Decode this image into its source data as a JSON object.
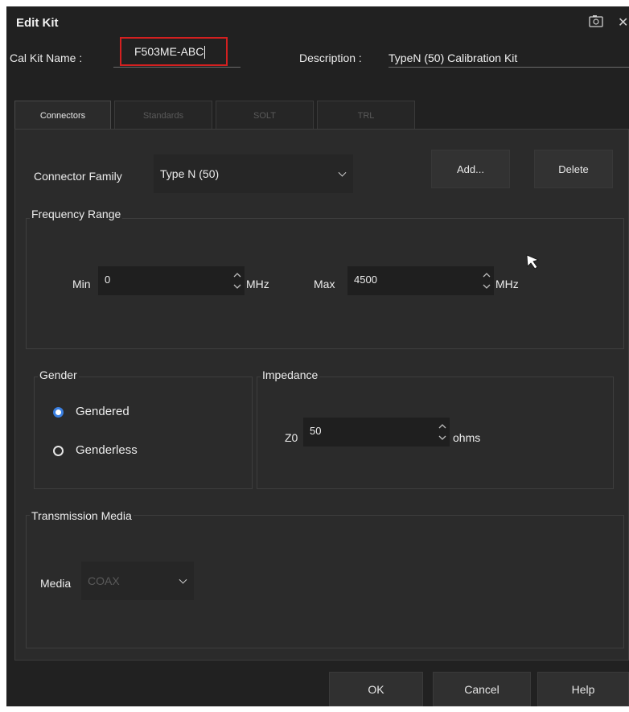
{
  "dialog": {
    "title": "Edit Kit"
  },
  "kit": {
    "name_label": "Cal Kit Name :",
    "name_value": "F503ME-ABC",
    "description_label": "Description :",
    "description_value": "TypeN (50) Calibration Kit"
  },
  "tabs": [
    {
      "label": "Connectors",
      "active": true
    },
    {
      "label": "Standards",
      "active": false
    },
    {
      "label": "SOLT",
      "active": false
    },
    {
      "label": "TRL",
      "active": false
    }
  ],
  "connectors": {
    "family_label": "Connector Family",
    "family_value": "Type N (50)",
    "add_label": "Add...",
    "delete_label": "Delete"
  },
  "frequency": {
    "title": "Frequency Range",
    "min_label": "Min",
    "min_value": "0",
    "min_unit": "MHz",
    "max_label": "Max",
    "max_value": "4500",
    "max_unit": "MHz"
  },
  "gender": {
    "title": "Gender",
    "options": [
      {
        "label": "Gendered",
        "selected": true
      },
      {
        "label": "Genderless",
        "selected": false
      }
    ]
  },
  "impedance": {
    "title": "Impedance",
    "z0_label": "Z0",
    "z0_value": "50",
    "unit": "ohms"
  },
  "transmission": {
    "title": "Transmission Media",
    "media_label": "Media",
    "media_value": "COAX"
  },
  "footer": {
    "ok_label": "OK",
    "cancel_label": "Cancel",
    "help_label": "Help"
  },
  "colors": {
    "background": "#212121",
    "panel": "#2b2b2b",
    "accent_radio": "#3a7fe0",
    "focus_border": "#d42020"
  }
}
